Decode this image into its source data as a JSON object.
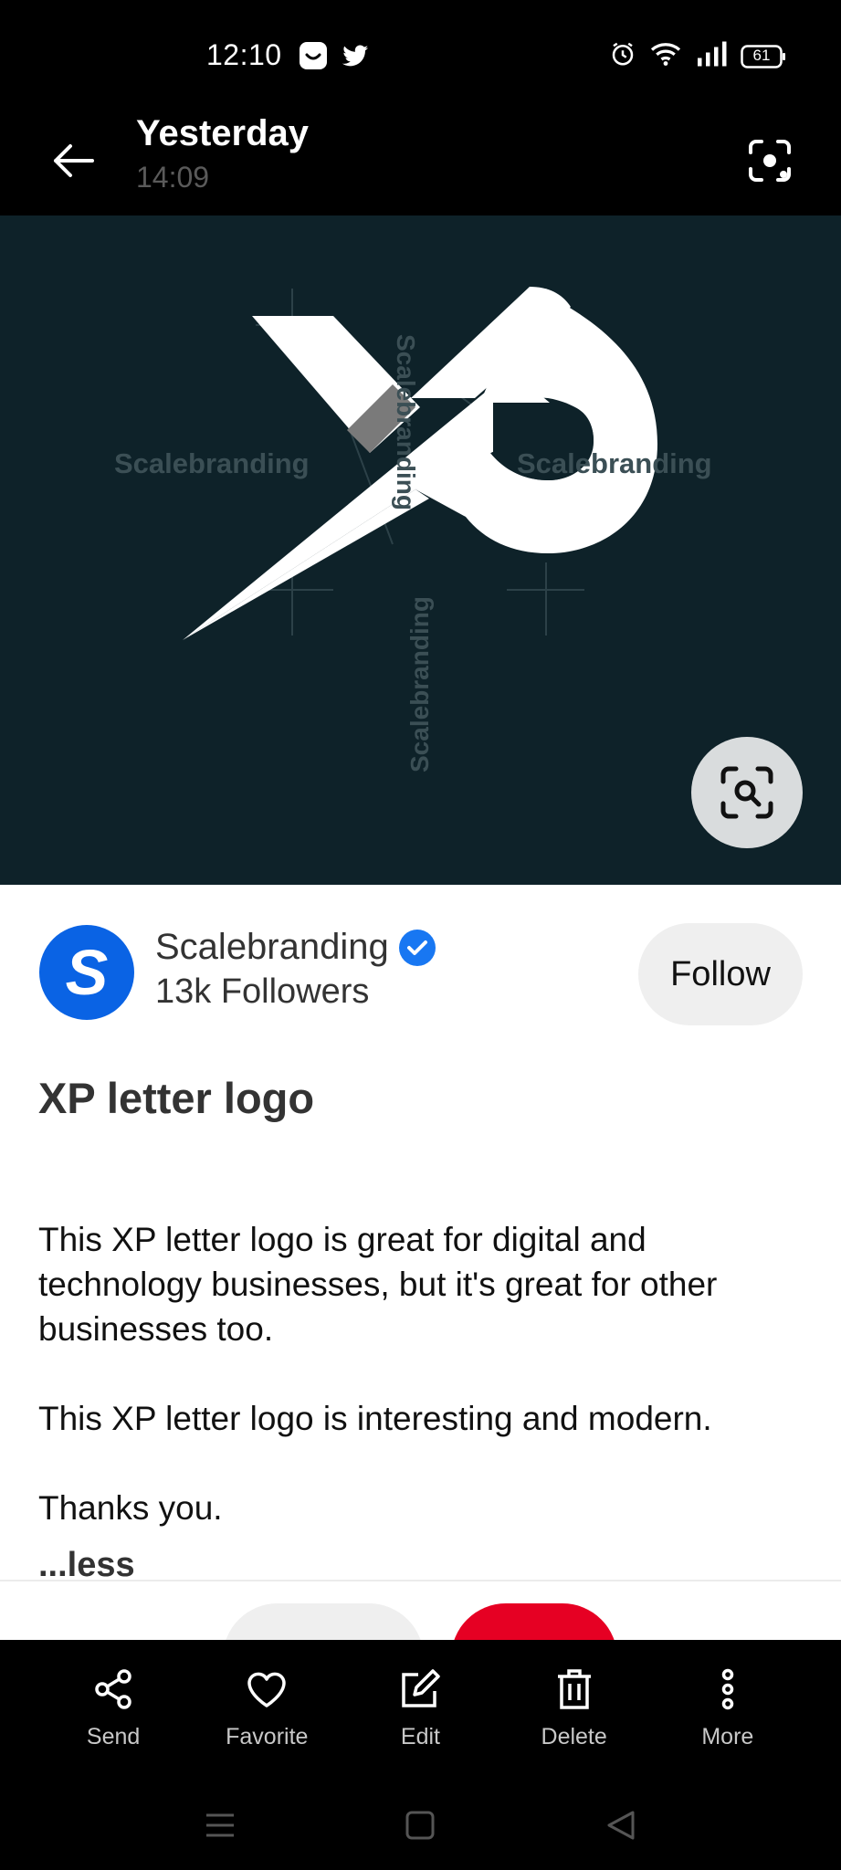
{
  "status_bar": {
    "time": "12:10",
    "battery": "61",
    "icons": [
      "face-app-icon",
      "twitter-icon",
      "alarm-icon",
      "wifi-icon",
      "signal-icon",
      "battery-icon"
    ]
  },
  "header": {
    "title": "Yesterday",
    "subtitle": "14:09"
  },
  "image": {
    "watermark_text": "Scalebranding",
    "background": "#0e2229"
  },
  "creator": {
    "avatar_letter": "S",
    "name": "Scalebranding",
    "followers": "13k Followers",
    "follow_label": "Follow"
  },
  "pin": {
    "title": "XP letter logo",
    "description": [
      "This XP letter logo is great for digital and technology businesses, but it's great for other businesses too.",
      "This XP letter logo is interesting and modern.",
      "Thanks you."
    ],
    "less_label": "...less"
  },
  "actions": [
    {
      "label": "Send",
      "icon": "share-icon"
    },
    {
      "label": "Favorite",
      "icon": "heart-icon"
    },
    {
      "label": "Edit",
      "icon": "edit-icon"
    },
    {
      "label": "Delete",
      "icon": "trash-icon"
    },
    {
      "label": "More",
      "icon": "more-vertical-icon"
    }
  ],
  "colors": {
    "accent_blue": "#0a63e4",
    "save_red": "#e60023",
    "verified_blue": "#1877f2"
  }
}
